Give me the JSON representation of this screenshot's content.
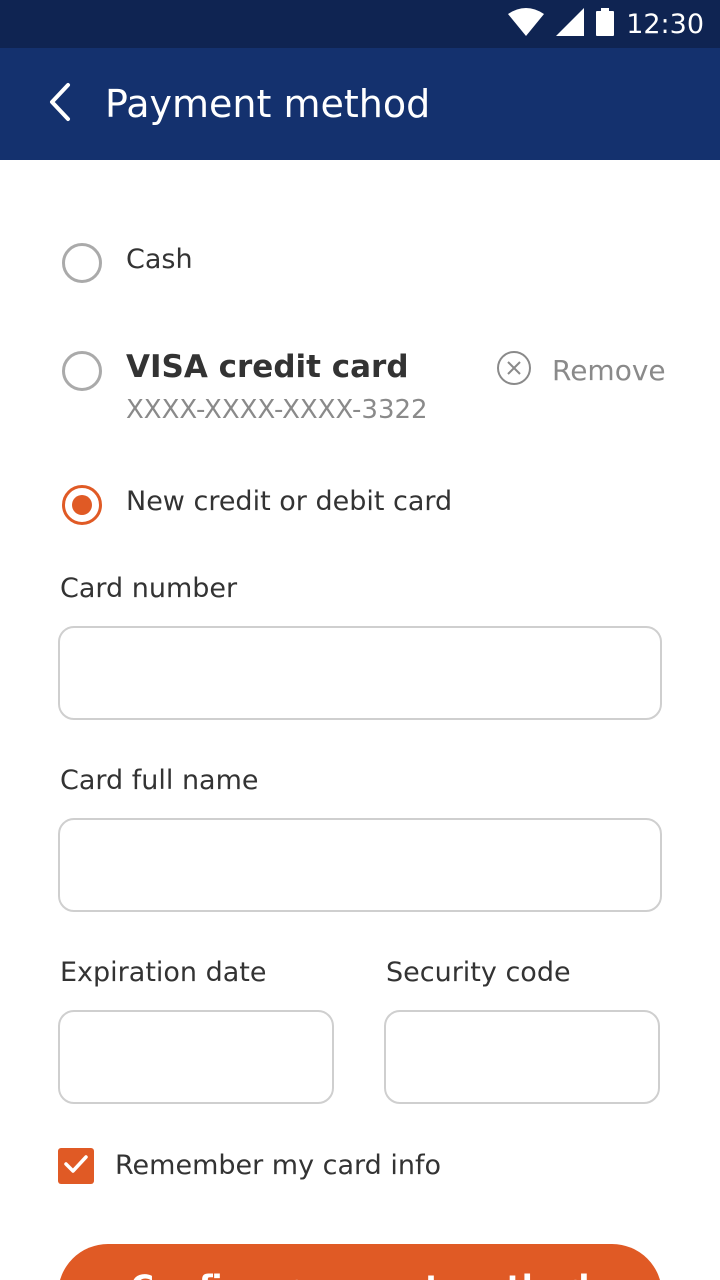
{
  "status_bar": {
    "time": "12:30",
    "icons": [
      "wifi-icon",
      "signal-icon",
      "battery-icon"
    ]
  },
  "app_bar": {
    "title": "Payment method",
    "back_icon": "chevron-left-icon"
  },
  "payment_options": [
    {
      "label": "Cash",
      "selected": false
    },
    {
      "label": "VISA credit card",
      "sublabel": "XXXX-XXXX-XXXX-3322",
      "selected": false,
      "remove_label": "Remove",
      "remove_icon": "close-circle-icon"
    },
    {
      "label": "New credit or debit card",
      "selected": true
    }
  ],
  "form": {
    "card_number_label": "Card number",
    "card_number_value": "",
    "card_name_label": "Card full name",
    "card_name_value": "",
    "expiration_label": "Expiration date",
    "expiration_value": "",
    "security_label": "Security code",
    "security_value": "",
    "remember_label": "Remember my card info",
    "remember_checked": true
  },
  "confirm_button": {
    "label": "Confirm payment method"
  },
  "colors": {
    "status_bar": "#0f2452",
    "app_bar": "#14316e",
    "accent": "#e05a25",
    "border": "#cfcfcf",
    "muted_text": "#8a8a8a"
  }
}
